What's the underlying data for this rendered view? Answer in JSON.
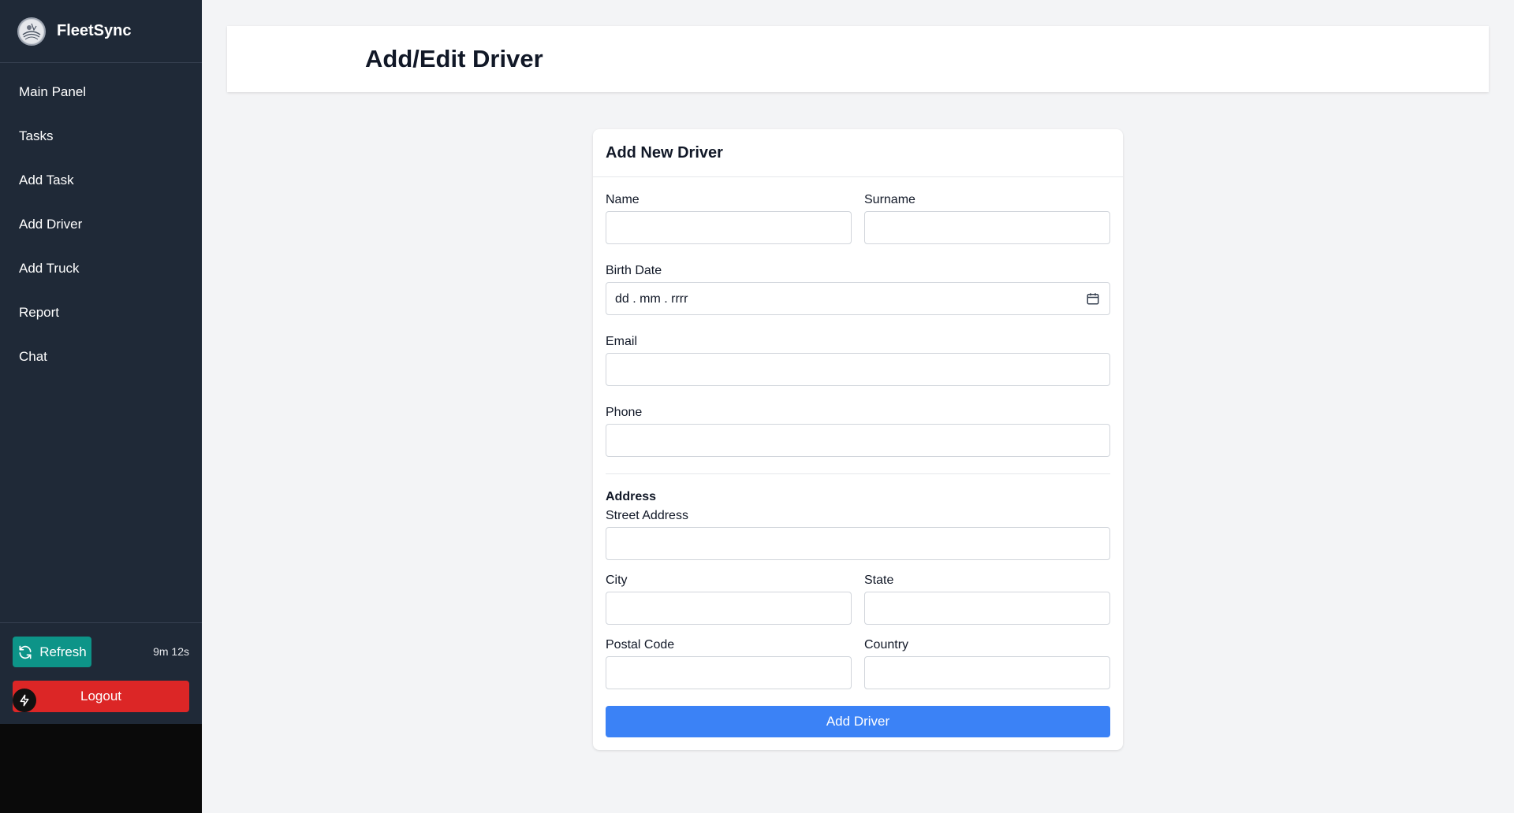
{
  "app": {
    "name": "FleetSync"
  },
  "sidebar": {
    "items": [
      {
        "label": "Main Panel"
      },
      {
        "label": "Tasks"
      },
      {
        "label": "Add Task"
      },
      {
        "label": "Add Driver"
      },
      {
        "label": "Add Truck"
      },
      {
        "label": "Report"
      },
      {
        "label": "Chat"
      }
    ],
    "refresh_label": "Refresh",
    "timer": "9m 12s",
    "logout_label": "Logout"
  },
  "header": {
    "title": "Add/Edit Driver"
  },
  "form": {
    "title": "Add New Driver",
    "name_label": "Name",
    "surname_label": "Surname",
    "birth_date_label": "Birth Date",
    "birth_date_placeholder": "dd . mm . rrrr",
    "email_label": "Email",
    "phone_label": "Phone",
    "address_section": "Address",
    "street_label": "Street Address",
    "city_label": "City",
    "state_label": "State",
    "postal_label": "Postal Code",
    "country_label": "Country",
    "submit_label": "Add Driver"
  },
  "colors": {
    "sidebar_bg": "#1f2937",
    "refresh": "#0d9488",
    "logout": "#dc2626",
    "primary": "#3b82f6"
  }
}
